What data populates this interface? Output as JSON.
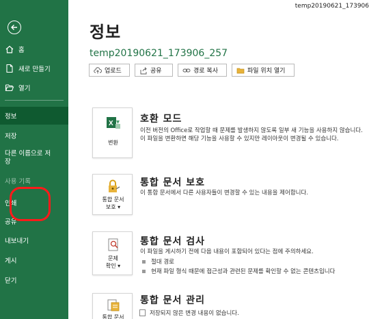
{
  "window": {
    "file_title": "temp20190621_173906"
  },
  "sidebar": {
    "home": "홈",
    "new": "새로 만들기",
    "open": "열기",
    "info": "정보",
    "save": "저장",
    "save_as": "다른 이름으로 저장",
    "history": "사용 기록",
    "print": "인쇄",
    "share": "공유",
    "export": "내보내기",
    "publish": "게시",
    "close": "닫기"
  },
  "main": {
    "title": "정보",
    "doc_name": "temp20190621_173906_257",
    "toolbar": {
      "upload": "업로드",
      "share": "공유",
      "copy_path": "경로 복사",
      "open_location": "파일 위치 열기"
    },
    "sections": [
      {
        "button_label": "변환",
        "title": "호환 모드",
        "description": "이전 버전의 Office로 작업할 때 문제를 발생하지 않도록 일부 새 기능을 사용하지 않습니다. 이 파일을 변환하면 해당 기능을 사용할 수 있지만 레이아웃이 변경될 수 있습니다."
      },
      {
        "button_label_1": "통합 문서",
        "button_label_2": "보호",
        "title": "통합 문서 보호",
        "description": "이 통합 문서에서 다른 사용자들이 변경할 수 있는 내용을 제어합니다."
      },
      {
        "button_label_1": "문제",
        "button_label_2": "확인",
        "title": "통합 문서 검사",
        "description": "이 파일을 게시하기 전에 다음 내용이 포함되어 있다는 점에 주의하세요.",
        "bullets": [
          "절대 경로",
          "현재 파일 형식 때문에 접근성과 관련된 문제를 확인할 수 없는 콘텐츠입니다"
        ]
      },
      {
        "button_label": "통합 문서",
        "title": "통합 문서 관리",
        "description": "저장되지 않은 변경 내용이 없습니다."
      }
    ]
  },
  "colors": {
    "sidebar": "#217346",
    "active": "#0f5a30",
    "accent": "#217346",
    "highlight": "#ff1a1a"
  }
}
